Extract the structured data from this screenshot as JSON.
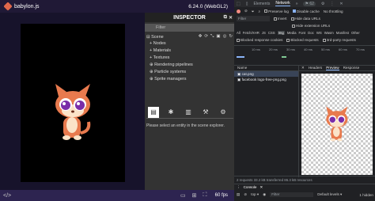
{
  "app": {
    "title": "babylon.js",
    "version": "6.24.0 (WebGL2)",
    "fps": "60 fps"
  },
  "inspector": {
    "title": "INSPECTOR",
    "filter_placeholder": "Filter",
    "scene_label": "Scene",
    "tree": [
      "Nodes",
      "Materials",
      "Textures",
      "Rendering pipelines",
      "Particle systems",
      "Sprite managers"
    ],
    "empty_message": "Please select an entity in the scene explorer."
  },
  "devtools": {
    "tabs": [
      "Elements",
      "Network"
    ],
    "active_tab": "Network",
    "issues_count": "62",
    "toolbar": {
      "preserve_log": "Preserve log",
      "disable_cache": "Disable cache",
      "throttling": "No throttling"
    },
    "filter_placeholder": "Filter",
    "invert": "Invert",
    "hide_data_urls": "Hide data URLs",
    "hide_extension_urls": "Hide extension URLs",
    "types": [
      "All",
      "Fetch/XHR",
      "JS",
      "CSS",
      "Img",
      "Media",
      "Font",
      "Doc",
      "WS",
      "Wasm",
      "Manifest",
      "Other"
    ],
    "active_type": "Img",
    "blocked_cookies": "Blocked response cookies",
    "blocked_requests": "Blocked requests",
    "third_party": "3rd-party requests",
    "timeline_labels": [
      "10 ms",
      "20 ms",
      "30 ms",
      "40 ms",
      "50 ms",
      "60 ms",
      "70 ms"
    ],
    "list_header": "Name",
    "requests": [
      "cat.png",
      "facebook logo-free-png.png"
    ],
    "selected_request": "cat.png",
    "preview_tabs": [
      "Headers",
      "Preview",
      "Response"
    ],
    "active_preview_tab": "Preview",
    "status": "2 requests  33.2 kB transferred  86.3 kB resources",
    "drawer_tab": "Console",
    "console_context": "top",
    "console_filter_placeholder": "Filter",
    "log_levels": "Default levels",
    "hidden_count": "1 hidden"
  },
  "colors": {
    "brand": "#e0684b",
    "inspector_bg": "#333333",
    "devtools_bg": "#202124"
  }
}
